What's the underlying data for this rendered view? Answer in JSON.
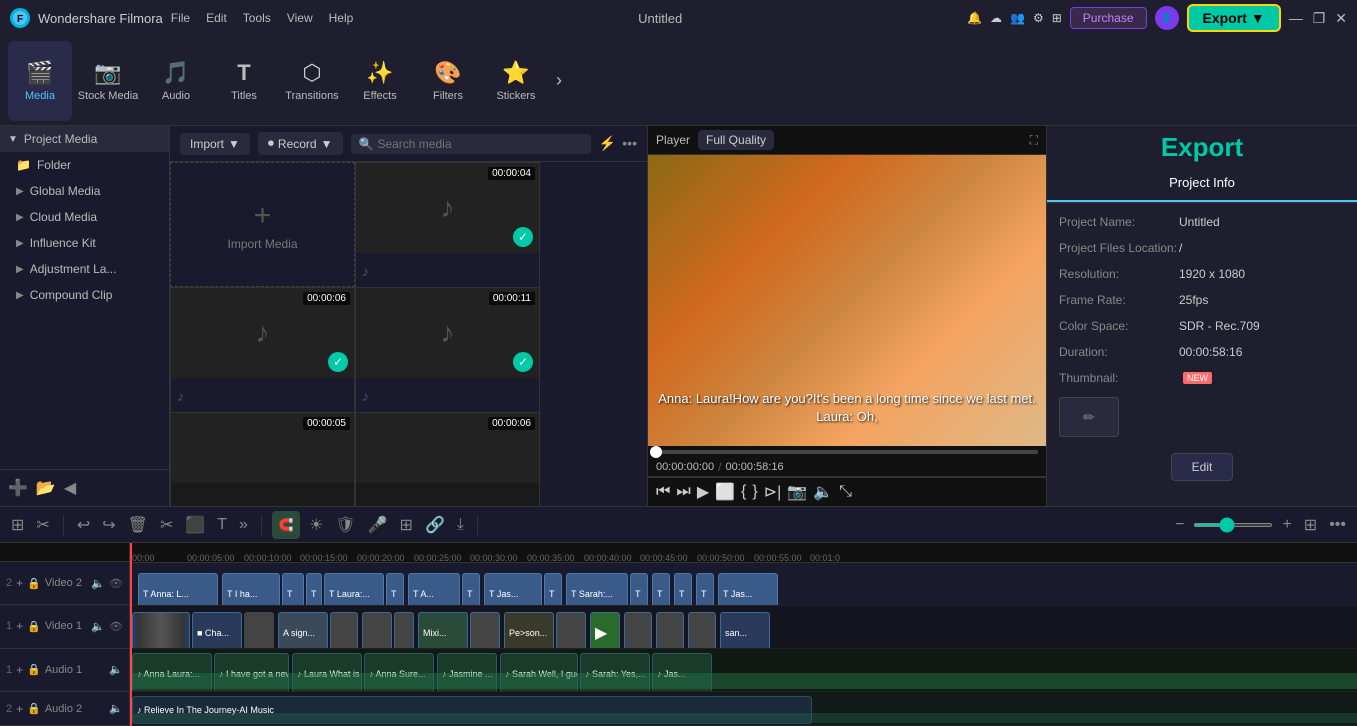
{
  "app": {
    "name": "Wondershare Filmora",
    "logo": "F",
    "title": "Untitled"
  },
  "titlebar": {
    "menu": [
      "File",
      "Edit",
      "Tools",
      "View",
      "Help"
    ],
    "purchase_label": "Purchase",
    "export_label": "Export",
    "win_controls": [
      "—",
      "❐",
      "✕"
    ]
  },
  "toolbar": {
    "items": [
      {
        "id": "media",
        "icon": "🎬",
        "label": "Media",
        "active": true
      },
      {
        "id": "stock",
        "icon": "📷",
        "label": "Stock Media",
        "active": false
      },
      {
        "id": "audio",
        "icon": "🎵",
        "label": "Audio",
        "active": false
      },
      {
        "id": "titles",
        "icon": "T",
        "label": "Titles",
        "active": false
      },
      {
        "id": "transitions",
        "icon": "⬡",
        "label": "Transitions",
        "active": false
      },
      {
        "id": "effects",
        "icon": "✨",
        "label": "Effects",
        "active": false
      },
      {
        "id": "filters",
        "icon": "🎨",
        "label": "Filters",
        "active": false
      },
      {
        "id": "stickers",
        "icon": "⭐",
        "label": "Stickers",
        "active": false
      }
    ],
    "more_arrow": "›"
  },
  "left_panel": {
    "header": "Project Media",
    "items": [
      {
        "label": "Folder"
      },
      {
        "label": "Global Media"
      },
      {
        "label": "Cloud Media"
      },
      {
        "label": "Influence Kit"
      },
      {
        "label": "Adjustment La..."
      },
      {
        "label": "Compound Clip"
      }
    ]
  },
  "media_area": {
    "import_label": "Import",
    "record_label": "Record",
    "search_placeholder": "Search media",
    "import_media_label": "Import Media",
    "cards": [
      {
        "type": "import",
        "label": "Import Media"
      },
      {
        "type": "audio",
        "duration": "00:00:04",
        "checked": true
      },
      {
        "type": "audio",
        "duration": "00:00:06",
        "checked": true
      },
      {
        "type": "audio",
        "duration": "00:00:11",
        "checked": true
      },
      {
        "type": "bar",
        "duration": "00:00:05"
      },
      {
        "type": "bar",
        "duration": "00:00:06"
      }
    ]
  },
  "player": {
    "label": "Player",
    "quality": "Full Quality",
    "subtitle": "Anna: Laura!How are you?It's been a long time since we last met.\nLaura: Oh,",
    "time_current": "00:00:00:00",
    "time_total": "00:00:58:16",
    "controls": [
      "⏮",
      "⏭",
      "▶",
      "⬜",
      "{",
      "}",
      "⊳|",
      "📷",
      "🔈",
      "⤡"
    ]
  },
  "right_panel": {
    "tabs": [
      "Project Info",
      ""
    ],
    "active_tab": "Project Info",
    "export_label": "Export",
    "fields": [
      {
        "label": "Project Name:",
        "value": "Untitled"
      },
      {
        "label": "Project Files Location:",
        "value": "/"
      },
      {
        "label": "Resolution:",
        "value": "1920 x 1080"
      },
      {
        "label": "Frame Rate:",
        "value": "25fps"
      },
      {
        "label": "Color Space:",
        "value": "SDR - Rec.709"
      },
      {
        "label": "Duration:",
        "value": "00:00:58:16"
      },
      {
        "label": "Thumbnail:",
        "value": "",
        "badge": "NEW"
      }
    ],
    "edit_label": "Edit"
  },
  "timeline": {
    "toolbar_buttons": [
      "⊞",
      "✂",
      "🗑",
      "✂",
      "▶▶",
      "T",
      "»"
    ],
    "snap_active": true,
    "zoom_minus": "−",
    "zoom_plus": "+",
    "tracks": [
      {
        "id": "video2",
        "name": "Video 2",
        "num": 2
      },
      {
        "id": "video1",
        "name": "Video 1",
        "num": 1
      },
      {
        "id": "audio1",
        "name": "Audio 1",
        "num": 1
      },
      {
        "id": "audio2",
        "name": "Audio 2",
        "num": 2
      }
    ],
    "ruler_marks": [
      "00:00",
      "00:00:05:00",
      "00:00:10:00",
      "00:00:15:00",
      "00:00:20:00",
      "00:00:25:00",
      "00:00:30:00",
      "00:00:35:00",
      "00:00:40:00",
      "00:00:45:00",
      "00:00:50:00",
      "00:00:55:00",
      "00:01:0"
    ]
  }
}
